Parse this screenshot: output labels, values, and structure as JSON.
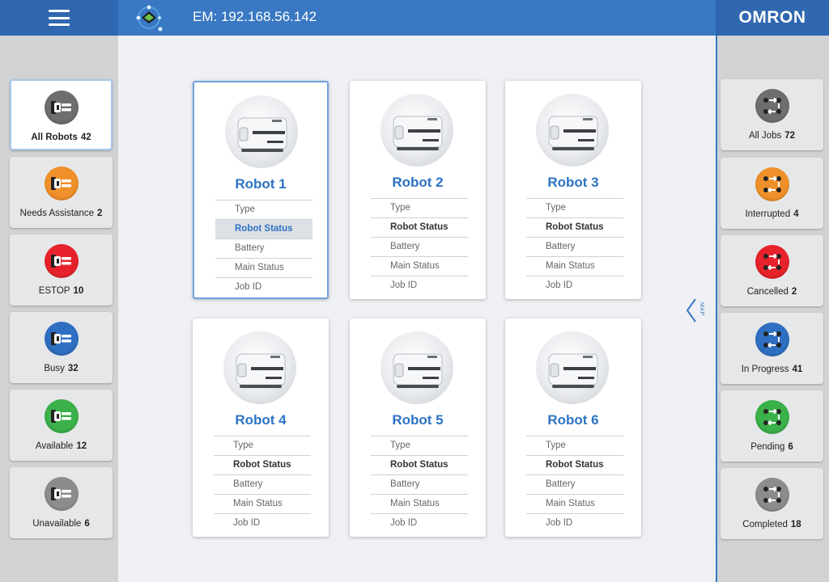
{
  "header": {
    "em_label": "EM: 192.168.56.142",
    "brand": "OMRON",
    "colors": {
      "bar": "#3a78c3",
      "blocks": "#2f67b0"
    }
  },
  "left_filters": [
    {
      "label": "All Robots",
      "count": "42",
      "color": "#6d6e70",
      "active": true
    },
    {
      "label": "Needs Assistance",
      "count": "2",
      "color": "#f0902a",
      "active": false
    },
    {
      "label": "ESTOP",
      "count": "10",
      "color": "#e8222a",
      "active": false
    },
    {
      "label": "Busy",
      "count": "32",
      "color": "#2e6fc2",
      "active": false
    },
    {
      "label": "Available",
      "count": "12",
      "color": "#3bb14a",
      "active": false
    },
    {
      "label": "Unavailable",
      "count": "6",
      "color": "#8b8c8e",
      "active": false
    }
  ],
  "right_filters": [
    {
      "label": "All Jobs",
      "count": "72",
      "color": "#6d6e70"
    },
    {
      "label": "Interrupted",
      "count": "4",
      "color": "#f0902a"
    },
    {
      "label": "Cancelled",
      "count": "2",
      "color": "#e8222a"
    },
    {
      "label": "In Progress",
      "count": "41",
      "color": "#2e6fc2"
    },
    {
      "label": "Pending",
      "count": "6",
      "color": "#3bb14a"
    },
    {
      "label": "Completed",
      "count": "18",
      "color": "#8b8c8e"
    }
  ],
  "robots": [
    {
      "name": "Robot 1",
      "fields": [
        "Type",
        "Robot Status",
        "Battery",
        "Main Status",
        "Job ID"
      ]
    },
    {
      "name": "Robot 2",
      "fields": [
        "Type",
        "Robot Status",
        "Battery",
        "Main Status",
        "Job ID"
      ]
    },
    {
      "name": "Robot 3",
      "fields": [
        "Type",
        "Robot Status",
        "Battery",
        "Main Status",
        "Job ID"
      ]
    },
    {
      "name": "Robot 4",
      "fields": [
        "Type",
        "Robot Status",
        "Battery",
        "Main Status",
        "Job ID"
      ]
    },
    {
      "name": "Robot 5",
      "fields": [
        "Type",
        "Robot Status",
        "Battery",
        "Main Status",
        "Job ID"
      ]
    },
    {
      "name": "Robot 6",
      "fields": [
        "Type",
        "Robot Status",
        "Battery",
        "Main Status",
        "Job ID"
      ]
    }
  ],
  "map_tab": {
    "label": "MAP"
  }
}
